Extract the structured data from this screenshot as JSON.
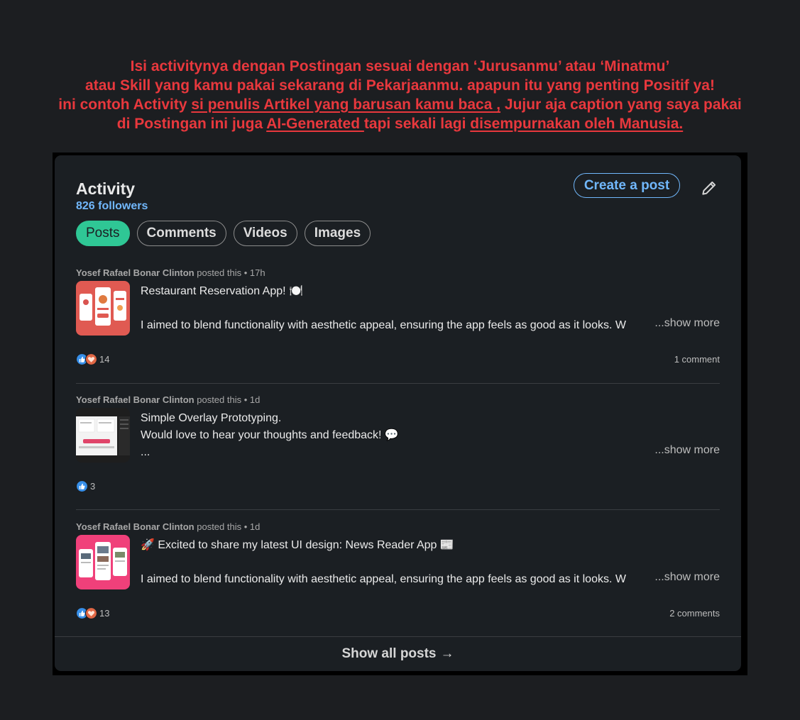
{
  "banner": {
    "line1": "Isi activitynya dengan Postingan sesuai dengan ‘Jurusanmu’ atau ‘Minatmu’",
    "line2": "atau Skill yang kamu pakai sekarang di Pekarjaanmu. apapun itu yang penting Positif ya!",
    "line3_a": "ini contoh Activity ",
    "line3_link": "si penulis Artikel yang barusan kamu baca ,",
    "line3_b": " Jujur aja caption yang saya pakai",
    "line4_a": "di Postingan ini juga ",
    "line4_link1": "AI-Generated ",
    "line4_b": "tapi sekali lagi ",
    "line4_link2": "disempurnakan oleh Manusia.",
    "color": "#e8383d"
  },
  "activity": {
    "title": "Activity",
    "followers": "826 followers",
    "create_post_label": "Create a post",
    "edit_icon": "pencil-icon",
    "tabs": [
      {
        "label": "Posts",
        "active": true
      },
      {
        "label": "Comments",
        "active": false
      },
      {
        "label": "Videos",
        "active": false
      },
      {
        "label": "Images",
        "active": false
      }
    ],
    "accent": "#2fc795",
    "link_color": "#71b7fb"
  },
  "posts": [
    {
      "author": "Yosef Rafael Bonar Clinton",
      "action": " posted this • ",
      "time": "17h",
      "line1": "Restaurant Reservation App! 🍽️",
      "line2": "",
      "line3": "I aimed to blend functionality with aesthetic appeal, ensuring the app feels as good as it looks. W",
      "show_more": "...show more",
      "reaction_count": "14",
      "comments": "1 comment"
    },
    {
      "author": "Yosef Rafael Bonar Clinton",
      "action": " posted this • ",
      "time": "1d",
      "line1": "Simple Overlay Prototyping.",
      "line2": "Would love to hear your thoughts and feedback! 💬",
      "line3": "...",
      "show_more": "...show more",
      "reaction_count": "3",
      "comments": ""
    },
    {
      "author": "Yosef Rafael Bonar Clinton",
      "action": " posted this • ",
      "time": "1d",
      "line1": "🚀 Excited to share my latest UI design: News Reader App 📰",
      "line2": "",
      "line3": "I aimed to blend functionality with aesthetic appeal, ensuring the app feels as good as it looks. W",
      "show_more": "...show more",
      "reaction_count": "13",
      "comments": "2 comments"
    }
  ],
  "footer": {
    "show_all": "Show all posts",
    "arrow": "→"
  }
}
